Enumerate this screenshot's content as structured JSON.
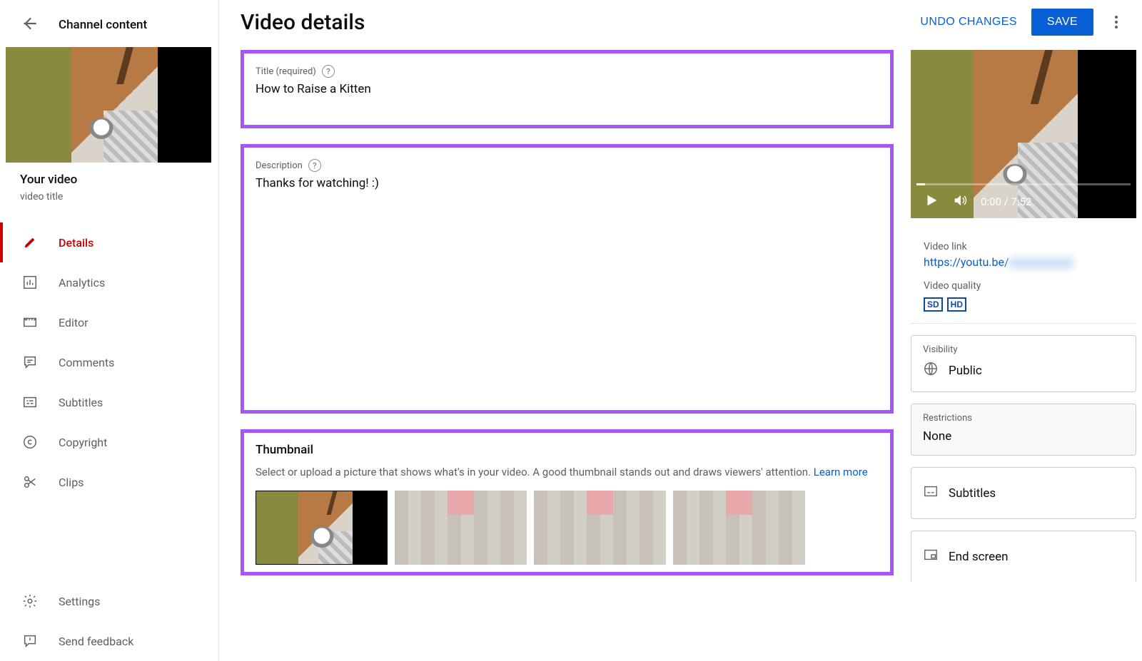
{
  "sidebar": {
    "back_label": "Back",
    "header": "Channel content",
    "your_video": "Your video",
    "video_title": "video title",
    "nav": {
      "details": "Details",
      "analytics": "Analytics",
      "editor": "Editor",
      "comments": "Comments",
      "subtitles": "Subtitles",
      "copyright": "Copyright",
      "clips": "Clips",
      "settings": "Settings",
      "feedback": "Send feedback"
    }
  },
  "header": {
    "title": "Video details",
    "undo": "UNDO CHANGES",
    "save": "SAVE"
  },
  "fields": {
    "title_label": "Title (required)",
    "title_value": "How to Raise a Kitten",
    "description_label": "Description",
    "description_value": "Thanks for watching! :)"
  },
  "thumbnail": {
    "heading": "Thumbnail",
    "description": "Select or upload a picture that shows what's in your video. A good thumbnail stands out and draws viewers' attention. ",
    "learn_more": "Learn more"
  },
  "preview": {
    "time": "0:00 / 7:52",
    "video_link_label": "Video link",
    "video_link": "https://youtu.be/",
    "video_quality_label": "Video quality",
    "sd": "SD",
    "hd": "HD"
  },
  "props": {
    "visibility_label": "Visibility",
    "visibility_value": "Public",
    "restrictions_label": "Restrictions",
    "restrictions_value": "None",
    "subtitles_label": "Subtitles",
    "endscreen_label": "End screen"
  }
}
